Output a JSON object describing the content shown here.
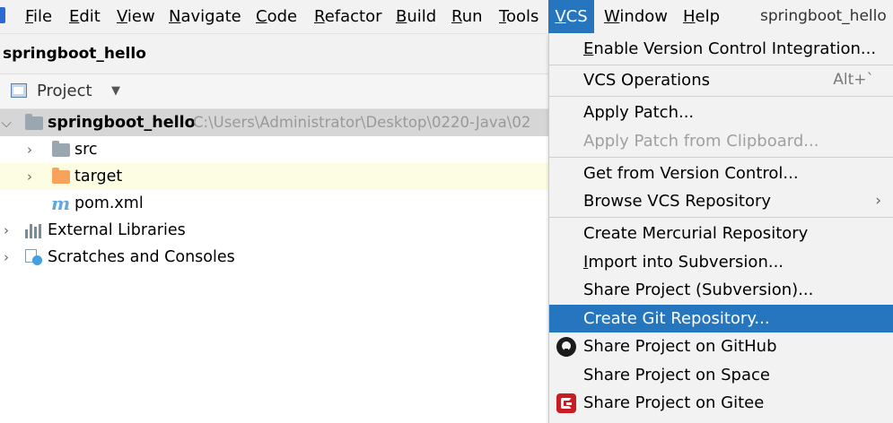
{
  "menubar": {
    "items": [
      {
        "label": "File",
        "mnemonic_index": 0
      },
      {
        "label": "Edit",
        "mnemonic_index": 0
      },
      {
        "label": "View",
        "mnemonic_index": 0
      },
      {
        "label": "Navigate",
        "mnemonic_index": 0
      },
      {
        "label": "Code",
        "mnemonic_index": 0
      },
      {
        "label": "Refactor",
        "mnemonic_index": 0
      },
      {
        "label": "Build",
        "mnemonic_index": 0
      },
      {
        "label": "Run",
        "mnemonic_index": 0
      },
      {
        "label": "Tools",
        "mnemonic_index": 0
      },
      {
        "label": "VCS",
        "mnemonic_index": 0
      },
      {
        "label": "Window",
        "mnemonic_index": 0
      },
      {
        "label": "Help",
        "mnemonic_index": 0
      }
    ],
    "window_title": "springboot_hello"
  },
  "project_bar": {
    "name": "springboot_hello"
  },
  "tool_window": {
    "label": "Project"
  },
  "tree": {
    "root": {
      "name": "springboot_hello",
      "path": "C:\\Users\\Administrator\\Desktop\\0220-Java\\02"
    },
    "src": "src",
    "target": "target",
    "pom": "pom.xml",
    "libs": "External Libraries",
    "scratches": "Scratches and Consoles"
  },
  "vcs_menu": {
    "items": [
      {
        "label": "Enable Version Control Integration...",
        "mnemonic": "E"
      },
      {
        "label": "VCS Operations",
        "shortcut": "Alt+`"
      },
      {
        "label": "Apply Patch..."
      },
      {
        "label": "Apply Patch from Clipboard...",
        "disabled": true
      },
      {
        "label": "Get from Version Control..."
      },
      {
        "label": "Browse VCS Repository",
        "submenu": true
      },
      {
        "label": "Create Mercurial Repository"
      },
      {
        "label": "Import into Subversion...",
        "mnemonic": "I"
      },
      {
        "label": "Share Project (Subversion)..."
      },
      {
        "label": "Create Git Repository...",
        "highlighted": true
      },
      {
        "label": "Share Project on GitHub",
        "icon": "github-icon"
      },
      {
        "label": "Share Project on Space"
      },
      {
        "label": "Share Project on Gitee",
        "icon": "gitee-icon"
      }
    ]
  }
}
